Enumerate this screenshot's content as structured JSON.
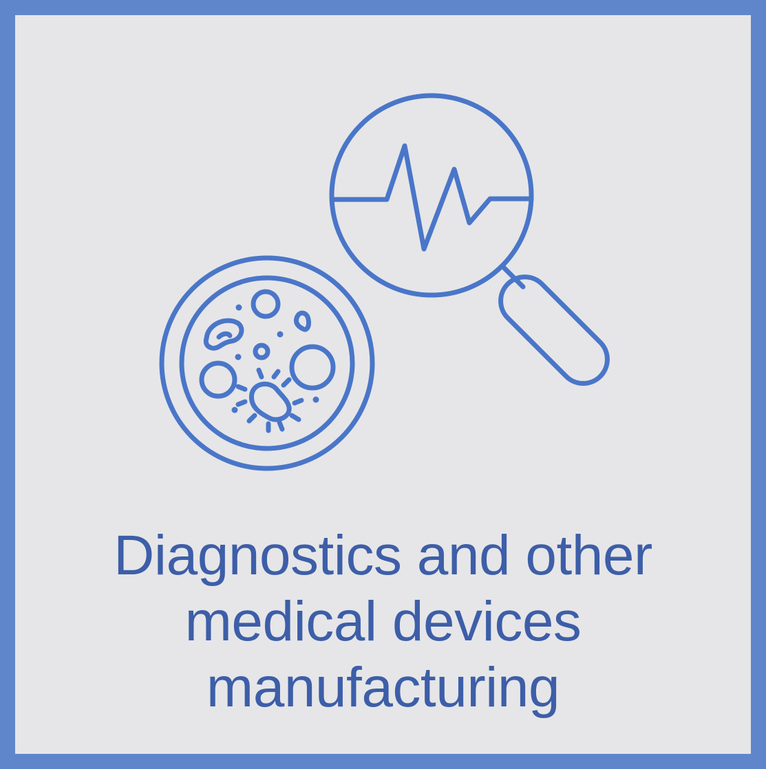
{
  "caption": {
    "line1": "Diagnostics and other",
    "line2": "medical devices",
    "line3": "manufacturing"
  },
  "icons": {
    "petri_dish": "petri-dish-icon",
    "magnifier": "magnifying-glass-icon",
    "pulse": "heartbeat-pulse-icon",
    "bacteria": "bacteria-icon"
  },
  "colors": {
    "frame": "#5f86cb",
    "background": "#e6e6e8",
    "icon_stroke": "#4a76c9",
    "text": "#3d5ea8"
  }
}
